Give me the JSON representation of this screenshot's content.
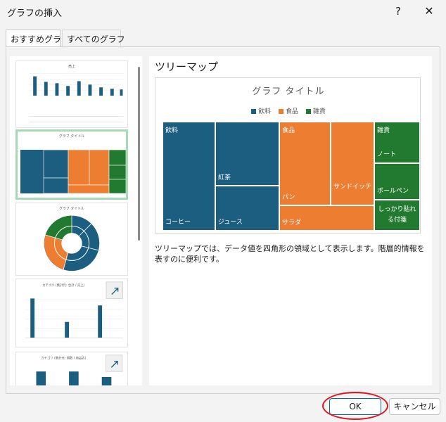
{
  "window": {
    "title": "グラフの挿入",
    "help_label": "?",
    "close_label": "✕"
  },
  "tabs": [
    {
      "label": "おすすめグラフ",
      "active": true
    },
    {
      "label": "すべてのグラフ",
      "active": false
    }
  ],
  "thumbnails": [
    {
      "title": "売上",
      "type": "bar",
      "selected": false
    },
    {
      "title": "グラフ タイトル",
      "type": "treemap",
      "selected": true
    },
    {
      "title": "グラフ タイトル",
      "type": "sunburst",
      "selected": false
    },
    {
      "title": "カテゴリ (集計元: 合計 / 売上)",
      "type": "bar",
      "selected": false
    },
    {
      "title": "カテゴリ (集計元: 個数 / 商品名)",
      "type": "bar",
      "selected": false
    }
  ],
  "preview": {
    "chart_name": "ツリーマップ",
    "description": "ツリーマップでは、データ値を四角形の領域として表示します。階層的情報を表すのに便利です。"
  },
  "chart_data": {
    "type": "treemap",
    "title": "グラフ タイトル",
    "legend": [
      {
        "name": "飲料",
        "color": "#1b5e80"
      },
      {
        "name": "食品",
        "color": "#ed7d31"
      },
      {
        "name": "雑貨",
        "color": "#217a2f"
      }
    ],
    "groups": [
      {
        "name": "飲料",
        "items": [
          "コーヒー",
          "紅茶",
          "ジュース"
        ]
      },
      {
        "name": "食品",
        "items": [
          "パン",
          "サンドイッチ",
          "サラダ"
        ]
      },
      {
        "name": "雑貨",
        "items": [
          "ノート",
          "ボールペン",
          "しっかり貼れる付箋"
        ]
      }
    ]
  },
  "buttons": {
    "ok_label": "OK",
    "cancel_label": "キャンセル"
  },
  "colors": {
    "beverage": "#1b5e80",
    "food": "#ed7d31",
    "goods": "#217a2f",
    "annotation": "#e0141e",
    "selected_border": "#a8d8b4"
  }
}
